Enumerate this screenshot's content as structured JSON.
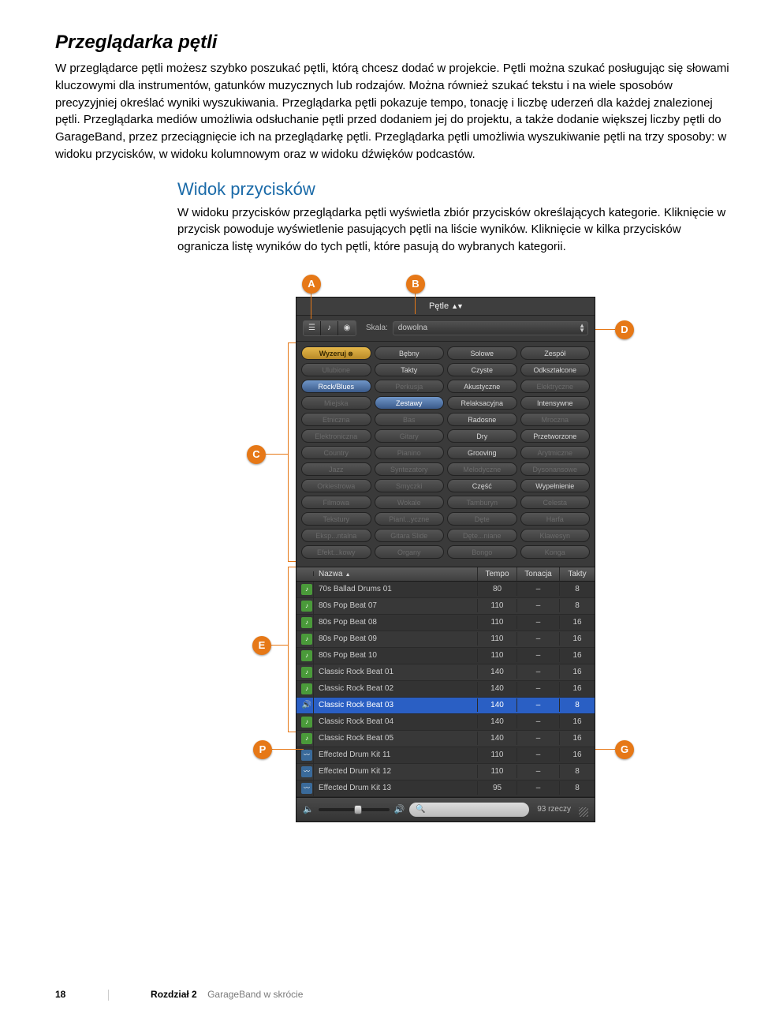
{
  "title": "Przeglądarka pętli",
  "intro": "W przeglądarce pętli możesz szybko poszukać pętli, którą chcesz dodać w projekcie. Pętli można szukać posługując się słowami kluczowymi dla instrumentów, gatunków muzycznych lub rodzajów. Można również szukać tekstu i na wiele sposobów precyzyjniej określać wyniki wyszukiwania. Przeglądarka pętli pokazuje tempo, tonację i liczbę uderzeń dla każdej znalezionej pętli. Przeglądarka mediów umożliwia odsłuchanie pętli przed dodaniem jej do projektu, a także dodanie większej liczby pętli do GarageBand, przez przeciągnięcie ich na przeglądarkę pętli. Przeglądarka pętli umożliwia wyszukiwanie pętli na trzy sposoby: w widoku przycisków, w widoku kolumnowym oraz w widoku dźwięków podcastów.",
  "section_title": "Widok przycisków",
  "section_body": "W widoku przycisków przeglądarka pętli wyświetla zbiór przycisków określających kategorie. Kliknięcie w przycisk powoduje wyświetlenie pasujących pętli na liście wyników. Kliknięcie w kilka przycisków ogranicza listę wyników do tych pętli, które pasują do wybranych kategorii.",
  "callouts": {
    "a": "A",
    "b": "B",
    "c": "C",
    "d": "D",
    "e": "E",
    "p": "P",
    "g": "G"
  },
  "panel": {
    "header": "Pętle",
    "scale_label": "Skala:",
    "scale_value": "dowolna",
    "cat_rows": [
      [
        {
          "t": "Wyzeruj",
          "s": "gold",
          "x": true
        },
        {
          "t": "Bębny"
        },
        {
          "t": "Solowe"
        },
        {
          "t": "Zespół"
        }
      ],
      [
        {
          "t": "Ulubione",
          "s": "dim"
        },
        {
          "t": "Takty"
        },
        {
          "t": "Czyste"
        },
        {
          "t": "Odkształcone"
        }
      ],
      [
        {
          "t": "Rock/Blues",
          "s": "blue"
        },
        {
          "t": "Perkusja",
          "s": "dim"
        },
        {
          "t": "Akustyczne"
        },
        {
          "t": "Elektryczne",
          "s": "dim"
        }
      ],
      [
        {
          "t": "Miejska",
          "s": "dim"
        },
        {
          "t": "Zestawy",
          "s": "blue"
        },
        {
          "t": "Relaksacyjna"
        },
        {
          "t": "Intensywne"
        }
      ],
      [
        {
          "t": "Etniczna",
          "s": "dim"
        },
        {
          "t": "Bas",
          "s": "dim"
        },
        {
          "t": "Radosne"
        },
        {
          "t": "Mroczna",
          "s": "dim"
        }
      ],
      [
        {
          "t": "Elektroniczna",
          "s": "dim"
        },
        {
          "t": "Gitary",
          "s": "dim"
        },
        {
          "t": "Dry"
        },
        {
          "t": "Przetworzone"
        }
      ],
      [
        {
          "t": "Country",
          "s": "dim"
        },
        {
          "t": "Pianino",
          "s": "dim"
        },
        {
          "t": "Grooving"
        },
        {
          "t": "Arytmiczne",
          "s": "dim"
        }
      ],
      [
        {
          "t": "Jazz",
          "s": "dim"
        },
        {
          "t": "Syntezatory",
          "s": "dim"
        },
        {
          "t": "Melodyczne",
          "s": "dim"
        },
        {
          "t": "Dysonansowe",
          "s": "dim"
        }
      ],
      [
        {
          "t": "Orkiestrowa",
          "s": "dim"
        },
        {
          "t": "Smyczki",
          "s": "dim"
        },
        {
          "t": "Część"
        },
        {
          "t": "Wypełnienie"
        }
      ],
      [
        {
          "t": "Filmowa",
          "s": "dim"
        },
        {
          "t": "Wokale",
          "s": "dim"
        },
        {
          "t": "Tamburyn",
          "s": "dim"
        },
        {
          "t": "Celesta",
          "s": "dim"
        }
      ],
      [
        {
          "t": "Tekstury",
          "s": "dim"
        },
        {
          "t": "Pianl...yczne",
          "s": "dim"
        },
        {
          "t": "Dęte",
          "s": "dim"
        },
        {
          "t": "Harfa",
          "s": "dim"
        }
      ],
      [
        {
          "t": "Eksp...ntalna",
          "s": "dim"
        },
        {
          "t": "Gitara Slide",
          "s": "dim"
        },
        {
          "t": "Dęte...niane",
          "s": "dim"
        },
        {
          "t": "Klawesyn",
          "s": "dim"
        }
      ],
      [
        {
          "t": "Efekt...kowy",
          "s": "dim"
        },
        {
          "t": "Organy",
          "s": "dim"
        },
        {
          "t": "Bongo",
          "s": "dim"
        },
        {
          "t": "Konga",
          "s": "dim"
        }
      ]
    ],
    "columns": {
      "name": "Nazwa",
      "tempo": "Tempo",
      "key": "Tonacja",
      "beats": "Takty"
    },
    "rows": [
      {
        "icon": "green",
        "name": "70s Ballad Drums 01",
        "tempo": "80",
        "key": "–",
        "beats": "8"
      },
      {
        "icon": "green",
        "name": "80s Pop Beat 07",
        "tempo": "110",
        "key": "–",
        "beats": "8"
      },
      {
        "icon": "green",
        "name": "80s Pop Beat 08",
        "tempo": "110",
        "key": "–",
        "beats": "16"
      },
      {
        "icon": "green",
        "name": "80s Pop Beat 09",
        "tempo": "110",
        "key": "–",
        "beats": "16"
      },
      {
        "icon": "green",
        "name": "80s Pop Beat 10",
        "tempo": "110",
        "key": "–",
        "beats": "16"
      },
      {
        "icon": "green",
        "name": "Classic Rock Beat 01",
        "tempo": "140",
        "key": "–",
        "beats": "16"
      },
      {
        "icon": "green",
        "name": "Classic Rock Beat 02",
        "tempo": "140",
        "key": "–",
        "beats": "16"
      },
      {
        "icon": "speaker",
        "name": "Classic Rock Beat 03",
        "tempo": "140",
        "key": "–",
        "beats": "8",
        "selected": true
      },
      {
        "icon": "green",
        "name": "Classic Rock Beat 04",
        "tempo": "140",
        "key": "–",
        "beats": "16"
      },
      {
        "icon": "green",
        "name": "Classic Rock Beat 05",
        "tempo": "140",
        "key": "–",
        "beats": "16"
      },
      {
        "icon": "blue",
        "name": "Effected Drum Kit 11",
        "tempo": "110",
        "key": "–",
        "beats": "16"
      },
      {
        "icon": "blue",
        "name": "Effected Drum Kit 12",
        "tempo": "110",
        "key": "–",
        "beats": "8"
      },
      {
        "icon": "blue",
        "name": "Effected Drum Kit 13",
        "tempo": "95",
        "key": "–",
        "beats": "8"
      }
    ],
    "count": "93 rzeczy"
  },
  "footer": {
    "page": "18",
    "chapter": "Rozdział 2",
    "chapter_title": "GarageBand w skrócie"
  }
}
